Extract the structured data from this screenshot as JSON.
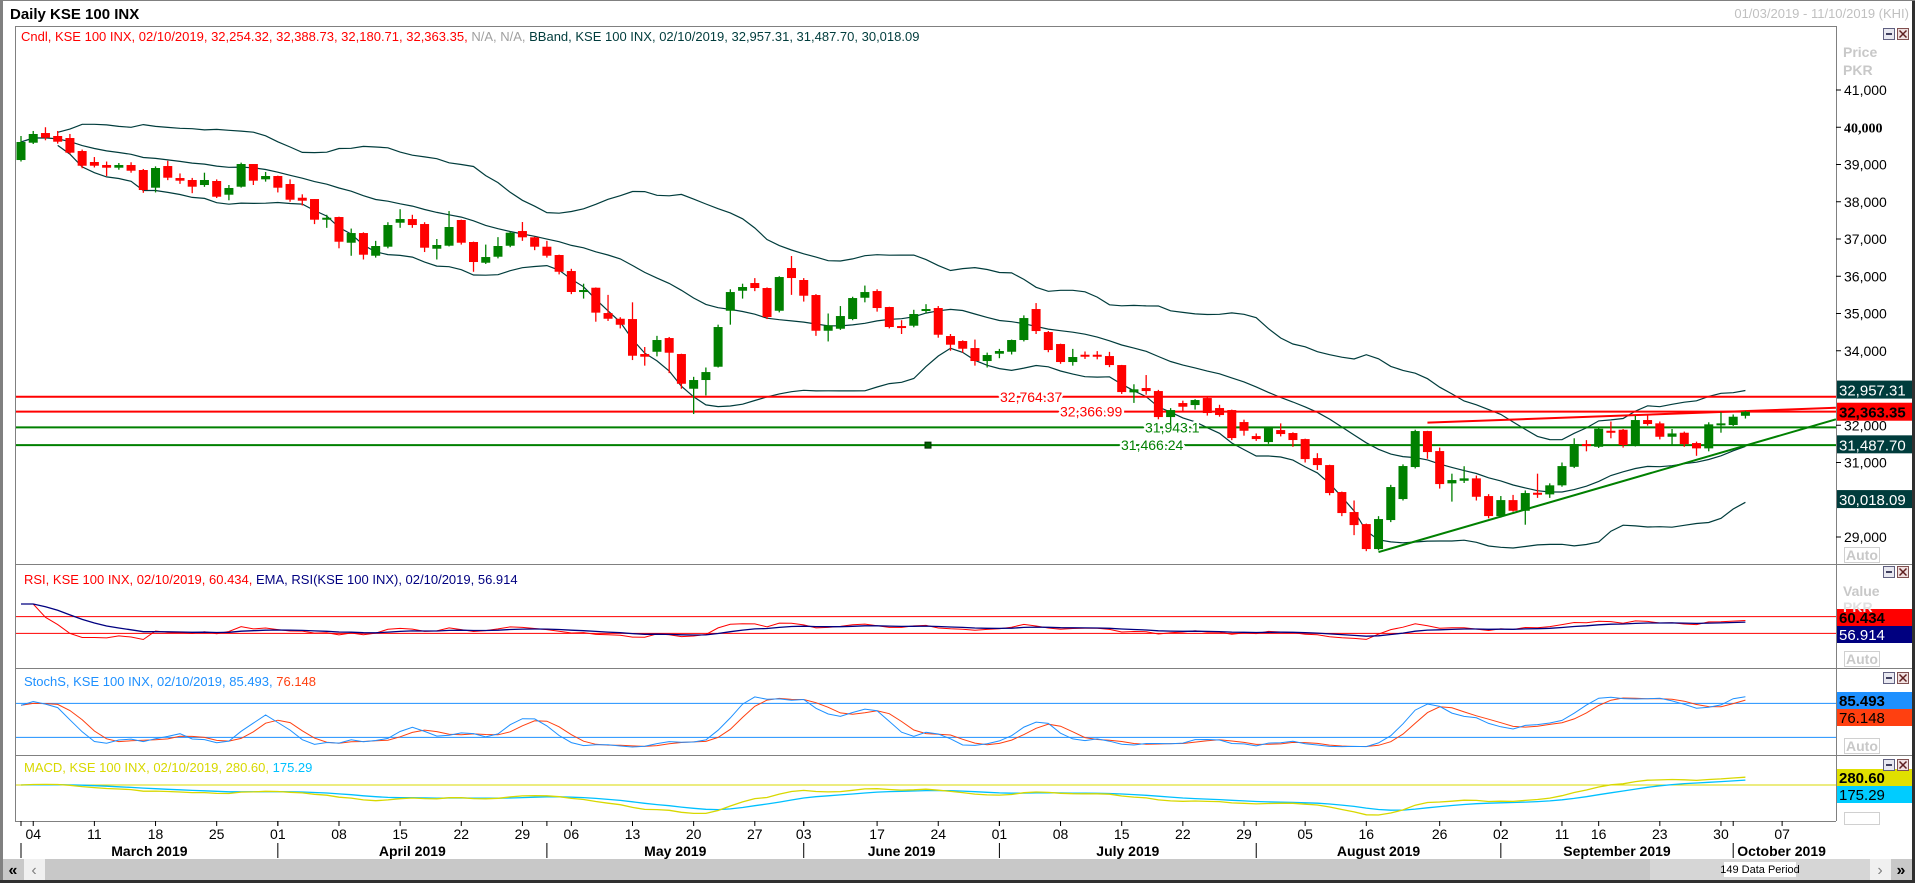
{
  "window": {
    "title": "Daily KSE 100 INX",
    "date_range": "01/03/2019 - 11/10/2019 (KHI)",
    "data_period": "149 Data Period",
    "auto_label": "Auto"
  },
  "price_pane": {
    "legend": {
      "cndl": "Cndl, KSE 100 INX, 02/10/2019, 32,254.32, 32,388.73, 32,180.71, 32,363.35,",
      "na": "N/A, N/A,",
      "bband": "BBand, KSE 100 INX, 02/10/2019, 32,957.31, 31,487.70, 30,018.09"
    },
    "axis_title": [
      "Price",
      "PKR"
    ],
    "value_boxes": [
      {
        "value": 32957.31,
        "text": "32,957.31",
        "bg": "#003c3c",
        "fg": "#ffffff"
      },
      {
        "value": 32363.35,
        "text": "32,363.35",
        "bg": "#ff0000",
        "fg": "#000000"
      },
      {
        "value": 31487.7,
        "text": "31,487.70",
        "bg": "#003c3c",
        "fg": "#ffffff"
      },
      {
        "value": 30018.09,
        "text": "30,018.09",
        "bg": "#003c3c",
        "fg": "#ffffff"
      }
    ]
  },
  "rsi_pane": {
    "legend": {
      "rsi": "RSI, KSE 100 INX, 02/10/2019, 60.434,",
      "ema": "EMA, RSI(KSE 100 INX), 02/10/2019, 56.914"
    },
    "axis_title": [
      "Value",
      "PKR"
    ],
    "value_boxes": [
      {
        "text": "60.434",
        "bg": "#ff0000",
        "fg": "#000000"
      },
      {
        "text": "56.914",
        "bg": "#000080",
        "fg": "#ffffff"
      }
    ]
  },
  "stoch_pane": {
    "legend": {
      "k": "StochS, KSE 100 INX, 02/10/2019, 85.493,",
      "d": "76.148"
    },
    "value_boxes": [
      {
        "text": "85.493",
        "bg": "#1e90ff",
        "fg": "#000000"
      },
      {
        "text": "76.148",
        "bg": "#ff4010",
        "fg": "#000000"
      }
    ]
  },
  "macd_pane": {
    "legend": {
      "macd": "MACD, KSE 100 INX, 02/10/2019, 280.60,",
      "signal": "175.29"
    },
    "value_boxes": [
      {
        "text": "280.60",
        "bg": "#e0e000",
        "fg": "#000000"
      },
      {
        "text": "175.29",
        "bg": "#00ccff",
        "fg": "#000000"
      }
    ]
  },
  "colors": {
    "up": "#008000",
    "down": "#ff0000",
    "bband": "#003c3c",
    "rsi": "#ff0000",
    "rsi_ema": "#000080",
    "stoch_k": "#1e90ff",
    "stoch_d": "#ff4010",
    "macd": "#d8d800",
    "macd_signal": "#00c0ff",
    "resistance": "#ff0000",
    "support": "#008000"
  },
  "chart_data": {
    "type": "candlestick",
    "symbol": "KSE 100 INX",
    "currency": "PKR",
    "ylim": [
      28500,
      41600
    ],
    "y_ticks": [
      {
        "value": 41000,
        "label": "41,000"
      },
      {
        "value": 40000,
        "label": "40,000",
        "bold": true
      },
      {
        "value": 39000,
        "label": "39,000"
      },
      {
        "value": 38000,
        "label": "38,000"
      },
      {
        "value": 37000,
        "label": "37,000"
      },
      {
        "value": 36000,
        "label": "36,000"
      },
      {
        "value": 35000,
        "label": "35,000"
      },
      {
        "value": 34000,
        "label": "34,000"
      },
      {
        "value": 32000,
        "label": "32,000"
      },
      {
        "value": 31000,
        "label": "31,000"
      },
      {
        "value": 29000,
        "label": "29,000"
      }
    ],
    "ohlc_fields": [
      "open",
      "high",
      "low",
      "close"
    ],
    "ohlc": [
      [
        39120,
        39765,
        39080,
        39604
      ],
      [
        39585,
        39900,
        39550,
        39819
      ],
      [
        39845,
        40000,
        39650,
        39719
      ],
      [
        39765,
        39900,
        39560,
        39612
      ],
      [
        39711,
        39820,
        39280,
        39317
      ],
      [
        39362,
        39400,
        38900,
        38967
      ],
      [
        39067,
        39200,
        38920,
        38967
      ],
      [
        38986,
        39080,
        38690,
        38914
      ],
      [
        38914,
        39040,
        38860,
        38986
      ],
      [
        38986,
        39060,
        38780,
        38833
      ],
      [
        38852,
        38880,
        38240,
        38315
      ],
      [
        38377,
        38950,
        38250,
        38906
      ],
      [
        38959,
        39100,
        38580,
        38645
      ],
      [
        38637,
        38760,
        38480,
        38565
      ],
      [
        38584,
        38640,
        38230,
        38404
      ],
      [
        38449,
        38780,
        38400,
        38584
      ],
      [
        38557,
        38600,
        38100,
        38135
      ],
      [
        38189,
        38450,
        38040,
        38369
      ],
      [
        38404,
        39050,
        38380,
        39013
      ],
      [
        39013,
        39013,
        38450,
        38565
      ],
      [
        38602,
        38800,
        38540,
        38691
      ],
      [
        38691,
        38700,
        38250,
        38377
      ],
      [
        38476,
        38600,
        38000,
        38055
      ],
      [
        38108,
        38200,
        37900,
        38028
      ],
      [
        38073,
        38073,
        37400,
        37518
      ],
      [
        37531,
        37650,
        37300,
        37571
      ],
      [
        37590,
        37600,
        36750,
        36927
      ],
      [
        36900,
        37280,
        36550,
        37160
      ],
      [
        37160,
        37180,
        36450,
        36578
      ],
      [
        36551,
        36950,
        36500,
        36812
      ],
      [
        36793,
        37450,
        36750,
        37375
      ],
      [
        37437,
        37800,
        37300,
        37536
      ],
      [
        37536,
        37650,
        37300,
        37375
      ],
      [
        37402,
        37450,
        36650,
        36766
      ],
      [
        36739,
        37000,
        36450,
        36839
      ],
      [
        36820,
        37750,
        36800,
        37322
      ],
      [
        37510,
        37520,
        36850,
        36900
      ],
      [
        36919,
        36930,
        36120,
        36382
      ],
      [
        36363,
        36850,
        36330,
        36516
      ],
      [
        36524,
        37050,
        36480,
        36812
      ],
      [
        36819,
        37200,
        36780,
        37169
      ],
      [
        37214,
        37456,
        36950,
        37045
      ],
      [
        37045,
        37060,
        36700,
        36793
      ],
      [
        36793,
        36950,
        36500,
        36551
      ],
      [
        36570,
        36580,
        36050,
        36121
      ],
      [
        36140,
        36200,
        35520,
        35577
      ],
      [
        35595,
        35800,
        35400,
        35630
      ],
      [
        35692,
        35700,
        34780,
        35023
      ],
      [
        35012,
        35500,
        34800,
        34859
      ],
      [
        34859,
        34900,
        34600,
        34698
      ],
      [
        34851,
        35300,
        33750,
        33866
      ],
      [
        33912,
        34100,
        33600,
        33840
      ],
      [
        33973,
        34400,
        33850,
        34288
      ],
      [
        34341,
        34370,
        33400,
        33947
      ],
      [
        33912,
        33920,
        32980,
        33114
      ],
      [
        32980,
        33300,
        32301,
        33214
      ],
      [
        33214,
        33550,
        32800,
        33428
      ],
      [
        33571,
        34700,
        33550,
        34637
      ],
      [
        35074,
        35650,
        34700,
        35576
      ],
      [
        35611,
        35800,
        35400,
        35711
      ],
      [
        35818,
        35950,
        35600,
        35684
      ],
      [
        35684,
        35700,
        34850,
        34905
      ],
      [
        35074,
        36000,
        35030,
        35979
      ],
      [
        36221,
        36543,
        35500,
        35952
      ],
      [
        35899,
        35950,
        35320,
        35477
      ],
      [
        35496,
        35520,
        34400,
        34537
      ],
      [
        34537,
        35000,
        34250,
        34682
      ],
      [
        34591,
        35200,
        34560,
        34932
      ],
      [
        34851,
        35450,
        34820,
        35415
      ],
      [
        35423,
        35750,
        35300,
        35576
      ],
      [
        35603,
        35650,
        35050,
        35147
      ],
      [
        35174,
        35180,
        34600,
        34637
      ],
      [
        34663,
        34820,
        34450,
        34637
      ],
      [
        34672,
        35100,
        34630,
        34986
      ],
      [
        35085,
        35250,
        35000,
        35120
      ],
      [
        35147,
        35200,
        34350,
        34430
      ],
      [
        34395,
        34450,
        34000,
        34162
      ],
      [
        34261,
        34280,
        33950,
        34054
      ],
      [
        34073,
        34300,
        33600,
        33724
      ],
      [
        33724,
        33950,
        33550,
        33885
      ],
      [
        33920,
        34050,
        33800,
        33993
      ],
      [
        33973,
        34300,
        33900,
        34288
      ],
      [
        34288,
        34950,
        34250,
        34878
      ],
      [
        35120,
        35280,
        34450,
        34529
      ],
      [
        34502,
        34530,
        33960,
        34019
      ],
      [
        34180,
        34190,
        33650,
        33697
      ],
      [
        33697,
        34050,
        33600,
        33832
      ],
      [
        33893,
        33980,
        33780,
        33858
      ],
      [
        33893,
        33990,
        33770,
        33858
      ],
      [
        33858,
        33970,
        33560,
        33616
      ],
      [
        33616,
        33620,
        32840,
        32891
      ],
      [
        32883,
        33100,
        32600,
        32964
      ],
      [
        32999,
        33348,
        32820,
        32918
      ],
      [
        32918,
        32950,
        32160,
        32220
      ],
      [
        32220,
        32460,
        32000,
        32408
      ],
      [
        32596,
        32660,
        32350,
        32497
      ],
      [
        32542,
        32700,
        32420,
        32677
      ],
      [
        32730,
        32760,
        32260,
        32328
      ],
      [
        32462,
        32550,
        32230,
        32274
      ],
      [
        32408,
        32420,
        31600,
        31656
      ],
      [
        32086,
        32150,
        31720,
        31852
      ],
      [
        31710,
        31780,
        31580,
        31629
      ],
      [
        31549,
        31960,
        31500,
        31925
      ],
      [
        31871,
        32050,
        31700,
        31764
      ],
      [
        31791,
        31810,
        31420,
        31603
      ],
      [
        31629,
        31640,
        31000,
        31092
      ],
      [
        31119,
        31250,
        30800,
        30931
      ],
      [
        30931,
        30940,
        30120,
        30180
      ],
      [
        30207,
        30220,
        29560,
        29643
      ],
      [
        29670,
        29980,
        29050,
        29320
      ],
      [
        29347,
        29360,
        28620,
        28676
      ],
      [
        28676,
        29560,
        28640,
        29482
      ],
      [
        29455,
        30400,
        29400,
        30341
      ],
      [
        30019,
        30950,
        29980,
        30905
      ],
      [
        30878,
        31880,
        30840,
        31844
      ],
      [
        31844,
        31850,
        31100,
        31280
      ],
      [
        31307,
        31400,
        30300,
        30421
      ],
      [
        30440,
        30700,
        29950,
        30529
      ],
      [
        30510,
        30900,
        30450,
        30574
      ],
      [
        30574,
        30650,
        29980,
        30080
      ],
      [
        30099,
        30150,
        29500,
        29562
      ],
      [
        29562,
        30100,
        29520,
        29991
      ],
      [
        29991,
        30130,
        29680,
        29704
      ],
      [
        29704,
        30250,
        29330,
        30180
      ],
      [
        30188,
        30700,
        30050,
        30144
      ],
      [
        30144,
        30440,
        30050,
        30387
      ],
      [
        30387,
        31000,
        30350,
        30904
      ],
      [
        30884,
        31650,
        30850,
        31495
      ],
      [
        31495,
        31600,
        31300,
        31450
      ],
      [
        31422,
        31950,
        31390,
        31906
      ],
      [
        31852,
        32100,
        31650,
        31817
      ],
      [
        31879,
        31900,
        31400,
        31468
      ],
      [
        31468,
        32250,
        31430,
        32140
      ],
      [
        32140,
        32300,
        31990,
        32033
      ],
      [
        32051,
        32100,
        31620,
        31691
      ],
      [
        31691,
        31900,
        31450,
        31780
      ],
      [
        31799,
        31830,
        31420,
        31495
      ],
      [
        31522,
        31560,
        31180,
        31379
      ],
      [
        31379,
        32080,
        31300,
        32024
      ],
      [
        32024,
        32350,
        31800,
        32051
      ],
      [
        32006,
        32290,
        31980,
        32229
      ],
      [
        32254,
        32388,
        32180,
        32363
      ]
    ],
    "horizontal_levels": [
      {
        "value": 32764.37,
        "label": "32,764.37",
        "color": "#ff0000"
      },
      {
        "value": 32366.99,
        "label": "32,366.99",
        "color": "#ff0000"
      },
      {
        "value": 31943.1,
        "label": "31,943.1",
        "color": "#008000"
      },
      {
        "value": 31466.24,
        "label": "31,466.24",
        "color": "#008000"
      }
    ],
    "trendlines": [
      {
        "kind": "resistance",
        "color": "#ff0000",
        "from": {
          "bar": 115,
          "price": 32070
        },
        "to": {
          "bar": 148.4,
          "price": 32470
        }
      },
      {
        "kind": "support",
        "color": "#008000",
        "from": {
          "bar": 111,
          "price": 28595
        },
        "to": {
          "bar": 148.4,
          "price": 32160
        }
      }
    ],
    "rsi_levels": [
      70,
      30
    ],
    "stoch_levels": [
      80,
      20
    ],
    "x_ticks": [
      {
        "bar": 1,
        "label": "04"
      },
      {
        "bar": 6,
        "label": "11"
      },
      {
        "bar": 11,
        "label": "18"
      },
      {
        "bar": 16,
        "label": "25"
      },
      {
        "bar": 21,
        "label": "01"
      },
      {
        "bar": 26,
        "label": "08"
      },
      {
        "bar": 31,
        "label": "15"
      },
      {
        "bar": 36,
        "label": "22"
      },
      {
        "bar": 41,
        "label": "29"
      },
      {
        "bar": 45,
        "label": "06"
      },
      {
        "bar": 50,
        "label": "13"
      },
      {
        "bar": 55,
        "label": "20"
      },
      {
        "bar": 60,
        "label": "27"
      },
      {
        "bar": 64,
        "label": "03"
      },
      {
        "bar": 70,
        "label": "17"
      },
      {
        "bar": 75,
        "label": "24"
      },
      {
        "bar": 80,
        "label": "01"
      },
      {
        "bar": 85,
        "label": "08"
      },
      {
        "bar": 90,
        "label": "15"
      },
      {
        "bar": 95,
        "label": "22"
      },
      {
        "bar": 100,
        "label": "29"
      },
      {
        "bar": 105,
        "label": "05"
      },
      {
        "bar": 110,
        "label": "16"
      },
      {
        "bar": 116,
        "label": "26"
      },
      {
        "bar": 121,
        "label": "02"
      },
      {
        "bar": 126,
        "label": "11"
      },
      {
        "bar": 129,
        "label": "16"
      },
      {
        "bar": 134,
        "label": "23"
      },
      {
        "bar": 139,
        "label": "30"
      },
      {
        "bar": 144,
        "label": "07"
      }
    ],
    "months": [
      {
        "label": "March 2019",
        "start": 0,
        "end": 21
      },
      {
        "label": "April 2019",
        "start": 21,
        "end": 43
      },
      {
        "label": "May 2019",
        "start": 43,
        "end": 64
      },
      {
        "label": "June 2019",
        "start": 64,
        "end": 80
      },
      {
        "label": "July 2019",
        "start": 80,
        "end": 101
      },
      {
        "label": "August 2019",
        "start": 101,
        "end": 121
      },
      {
        "label": "September 2019",
        "start": 121,
        "end": 140
      },
      {
        "label": "October 2019",
        "start": 140,
        "end": 148
      }
    ]
  }
}
